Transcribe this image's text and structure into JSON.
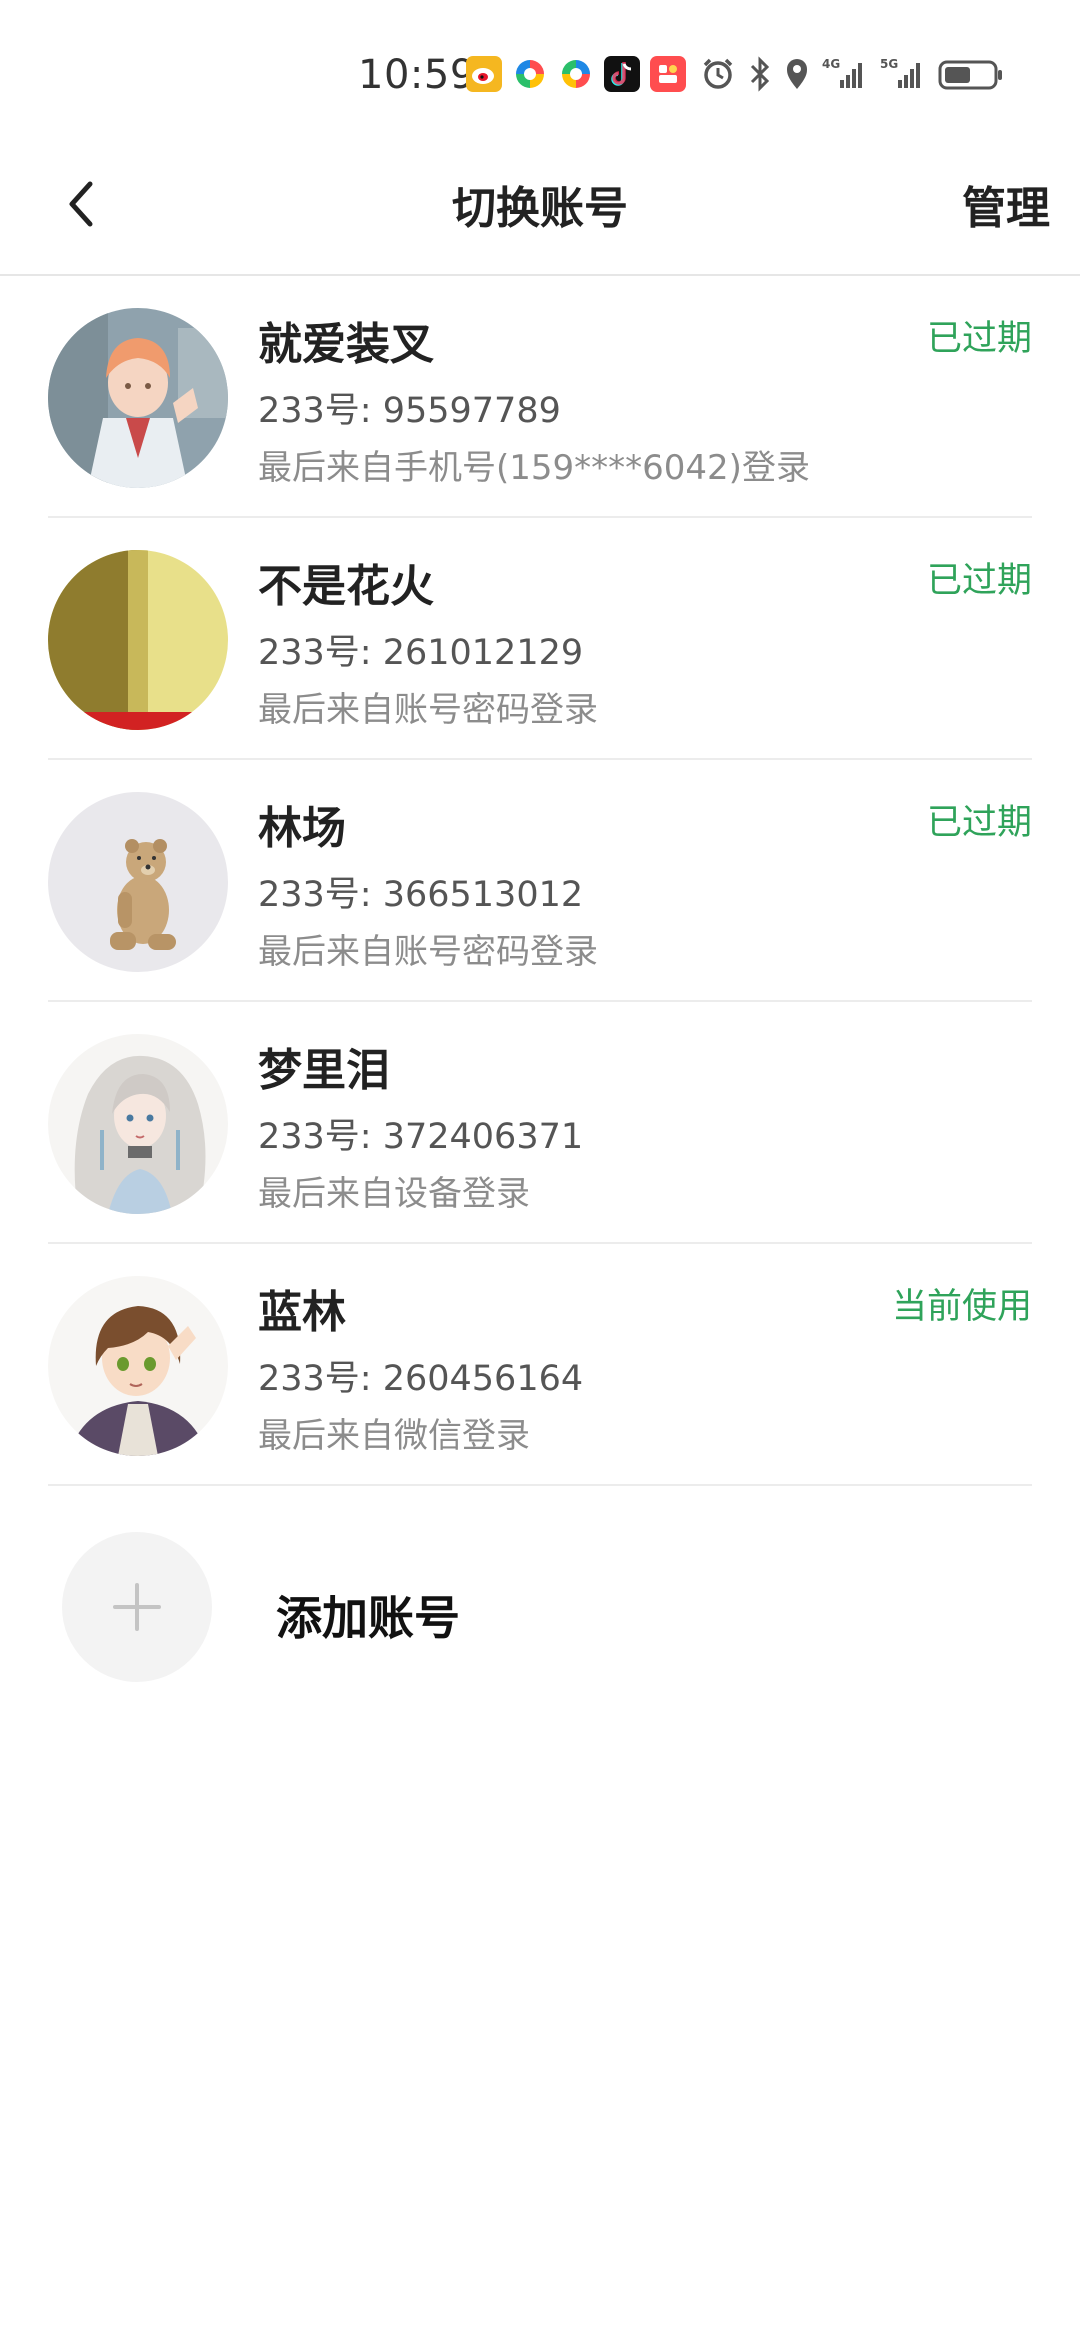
{
  "status_bar": {
    "time": "10:59",
    "app_icons": [
      {
        "name": "weibo-icon",
        "color": "#f5b720"
      },
      {
        "name": "browser-icon",
        "color": "#3aa0ff"
      },
      {
        "name": "browser-icon-2",
        "color": "#2bbf6a"
      },
      {
        "name": "tiktok-icon",
        "color": "#111111"
      },
      {
        "name": "app-icon-red",
        "color": "#ff4d4f"
      }
    ],
    "network": [
      "4G",
      "5G"
    ],
    "battery_level": 0.55
  },
  "nav": {
    "title": "切换账号",
    "manage_label": "管理",
    "back_icon": "chevron-left-icon"
  },
  "accounts": [
    {
      "name": "就爱装叉",
      "id_text": "233号: 95597789",
      "login_text": "最后来自手机号(159****6042)登录",
      "status": "已过期",
      "avatar_theme": "anime-boy-orange"
    },
    {
      "name": "不是花火",
      "id_text": "233号: 261012129",
      "login_text": "最后来自账号密码登录",
      "status": "已过期",
      "avatar_theme": "yellow-wall"
    },
    {
      "name": "林场",
      "id_text": "233号: 366513012",
      "login_text": "最后来自账号密码登录",
      "status": "已过期",
      "avatar_theme": "teddy-bear"
    },
    {
      "name": "梦里泪",
      "id_text": "233号: 372406371",
      "login_text": "最后来自设备登录",
      "status": "",
      "avatar_theme": "anime-girl-silver"
    },
    {
      "name": "蓝林",
      "id_text": "233号: 260456164",
      "login_text": "最后来自微信登录",
      "status": "当前使用",
      "avatar_theme": "anime-boy-brown"
    }
  ],
  "add_account": {
    "label": "添加账号",
    "icon": "plus-icon"
  },
  "colors": {
    "status_green": "#2fa35a",
    "divider": "#ececec",
    "add_circle_bg": "#f3f3f3"
  }
}
